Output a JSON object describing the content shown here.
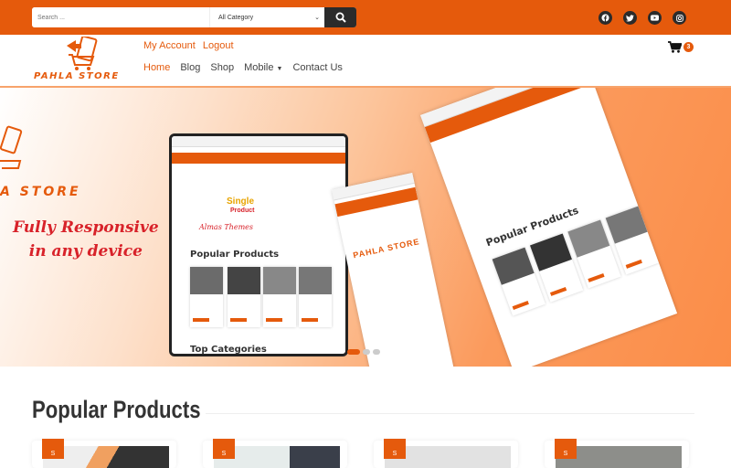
{
  "topbar": {
    "search_placeholder": "Search ...",
    "category_selected": "All Category",
    "social": [
      "facebook-icon",
      "twitter-icon",
      "youtube-icon",
      "instagram-icon"
    ]
  },
  "header": {
    "logo_text": "PAHLA STORE",
    "account_links": [
      "My Account",
      "Logout"
    ],
    "nav": [
      "Home",
      "Blog",
      "Shop",
      "Mobile",
      "Contact Us"
    ],
    "cart_count": "3"
  },
  "hero": {
    "brand_fragment": "A STORE",
    "headline_line1": "Fully Responsive",
    "headline_line2": "in any device",
    "mockup": {
      "section_popular": "Popular Products",
      "section_categories": "Top Categories",
      "single_product": "Single",
      "product_label": "Product",
      "almas": "Almas Themes"
    },
    "slider": {
      "total": 3,
      "active": 1
    }
  },
  "popular": {
    "title": "Popular Products",
    "sale_tag": "S"
  },
  "colors": {
    "accent": "#e55a0c",
    "dark": "#2b2b2b",
    "hero_red": "#d8222a"
  }
}
